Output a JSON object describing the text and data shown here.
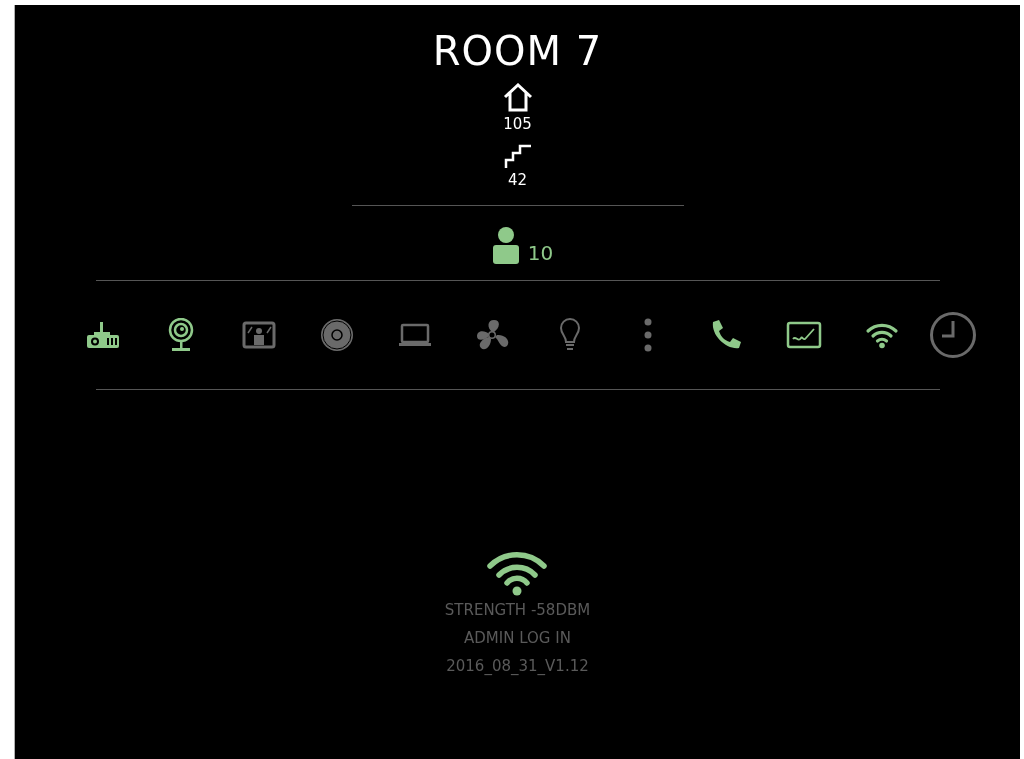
{
  "title": "ROOM 7",
  "stats": [
    {
      "kind": "house",
      "value": "105"
    },
    {
      "kind": "stairs",
      "value": "42"
    }
  ],
  "occupancy": {
    "value": "10"
  },
  "devices": [
    {
      "kind": "projector",
      "on": true
    },
    {
      "kind": "webcam",
      "on": true
    },
    {
      "kind": "frame",
      "on": false
    },
    {
      "kind": "disc",
      "on": false
    },
    {
      "kind": "laptop",
      "on": false
    },
    {
      "kind": "fan",
      "on": false
    },
    {
      "kind": "bulb",
      "on": false
    },
    {
      "kind": "more",
      "on": false
    },
    {
      "kind": "phone",
      "on": true
    },
    {
      "kind": "signature",
      "on": true
    },
    {
      "kind": "wifi",
      "on": true
    }
  ],
  "footer": {
    "strength": "STRENGTH -58DBM",
    "admin": "ADMIN LOG IN",
    "version": "2016_08_31_V1.12"
  }
}
